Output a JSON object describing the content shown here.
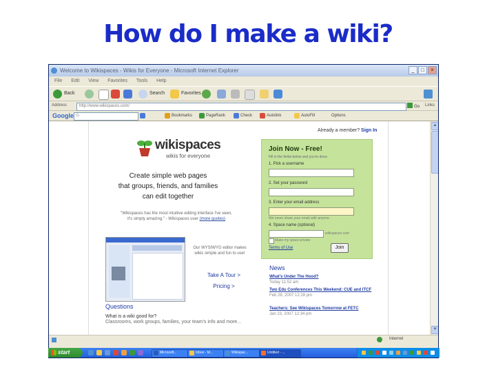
{
  "slide": {
    "title": "How do I make a wiki?"
  },
  "browser": {
    "window_title": "Welcome to Wikispaces - Wikis for Everyone - Microsoft Internet Explorer",
    "menu": [
      "File",
      "Edit",
      "View",
      "Favorites",
      "Tools",
      "Help"
    ],
    "toolbar": {
      "back": "Back",
      "search": "Search",
      "favorites": "Favorites"
    },
    "address_label": "Address",
    "address_value": "http://www.wikispaces.com/",
    "go_label": "Go",
    "links_label": "Links"
  },
  "googlebar": {
    "logo": "Google",
    "field_value": "G-",
    "items": [
      "Go",
      "Bookmarks",
      "PageRank",
      "Check",
      "Autolink",
      "AutoFill",
      "Options"
    ]
  },
  "page": {
    "member_prompt": "Already a member?",
    "sign_in": "Sign In",
    "logo_name": "wikispaces",
    "logo_tagline": "wikis for everyone",
    "headline_lines": [
      "Create simple web pages",
      "that groups, friends, and families",
      "can edit together"
    ],
    "quote": "\"Wikispaces has the most intuitive editing interface I've seen, it's simply amazing.\" - Wikispaces user",
    "quote_link": "(more quotes)",
    "feature_blurb": "Our WYSIWYG editor makes wikis simple and fun to use!",
    "take_tour": "Take A Tour >",
    "pricing": "Pricing >",
    "questions_heading": "Questions",
    "question_1": "What is a wiki good for?",
    "question_1_desc": "Classrooms, work groups, families, your team's info and more..."
  },
  "join": {
    "title": "Join Now - Free!",
    "note": "Fill in the fields below and you're done.",
    "step1": "1. Pick a username",
    "step2": "2. Set your password",
    "step3": "3. Enter your email address",
    "email_hint": "We never share your email with anyone.",
    "step4": "4. Space name (optional)",
    "space_hint": "wikispaces.com",
    "private_label": "Make my space private",
    "terms": "Terms of Use",
    "join_button": "Join"
  },
  "news": {
    "heading": "News",
    "items": [
      {
        "title": "What's Under The Hood?",
        "date": "Today 11:52 am"
      },
      {
        "title": "Two Edu Conferences This Weekend: CUE and ITCF",
        "date": "Feb 28, 2007 12:28 pm"
      },
      {
        "title": "Teachers: See Wikispaces Tomorrow at FETC",
        "date": "Jan 23, 2007 12:34 pm"
      }
    ]
  },
  "statusbar": {
    "zone": "Internet"
  },
  "taskbar": {
    "start": "start",
    "buttons": [
      "Microsoft...",
      "Inbox - M...",
      "Wikispac...",
      "Untitled - ..."
    ]
  },
  "colors": {
    "title_blue": "#1a2cc8",
    "link_blue": "#1e3aa0",
    "join_green": "#c5e39b",
    "xp_blue": "#245edb"
  }
}
